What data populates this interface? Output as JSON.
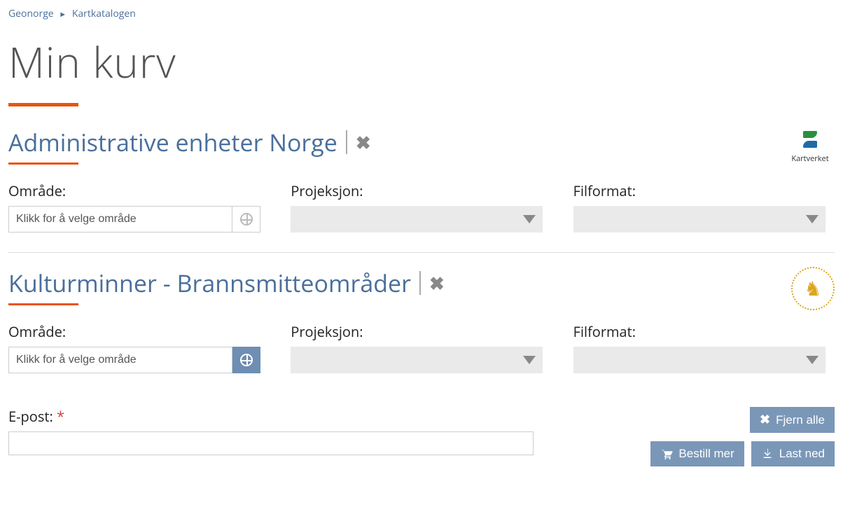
{
  "breadcrumb": {
    "home": "Geonorge",
    "current": "Kartkatalogen"
  },
  "page_title": "Min kurv",
  "datasets": [
    {
      "title": "Administrative enheter Norge",
      "org_label": "Kartverket",
      "globe_active": false,
      "area": {
        "label": "Område:",
        "placeholder": "Klikk for å velge område"
      },
      "projection": {
        "label": "Projeksjon:"
      },
      "format": {
        "label": "Filformat:"
      }
    },
    {
      "title": "Kulturminner - Brannsmitteområder",
      "org_label": "",
      "globe_active": true,
      "area": {
        "label": "Område:",
        "placeholder": "Klikk for å velge område"
      },
      "projection": {
        "label": "Projeksjon:"
      },
      "format": {
        "label": "Filformat:"
      }
    }
  ],
  "email": {
    "label": "E-post:",
    "required_mark": "*",
    "value": ""
  },
  "buttons": {
    "clear_all": "Fjern alle",
    "order_more": "Bestill mer",
    "download": "Last ned"
  }
}
